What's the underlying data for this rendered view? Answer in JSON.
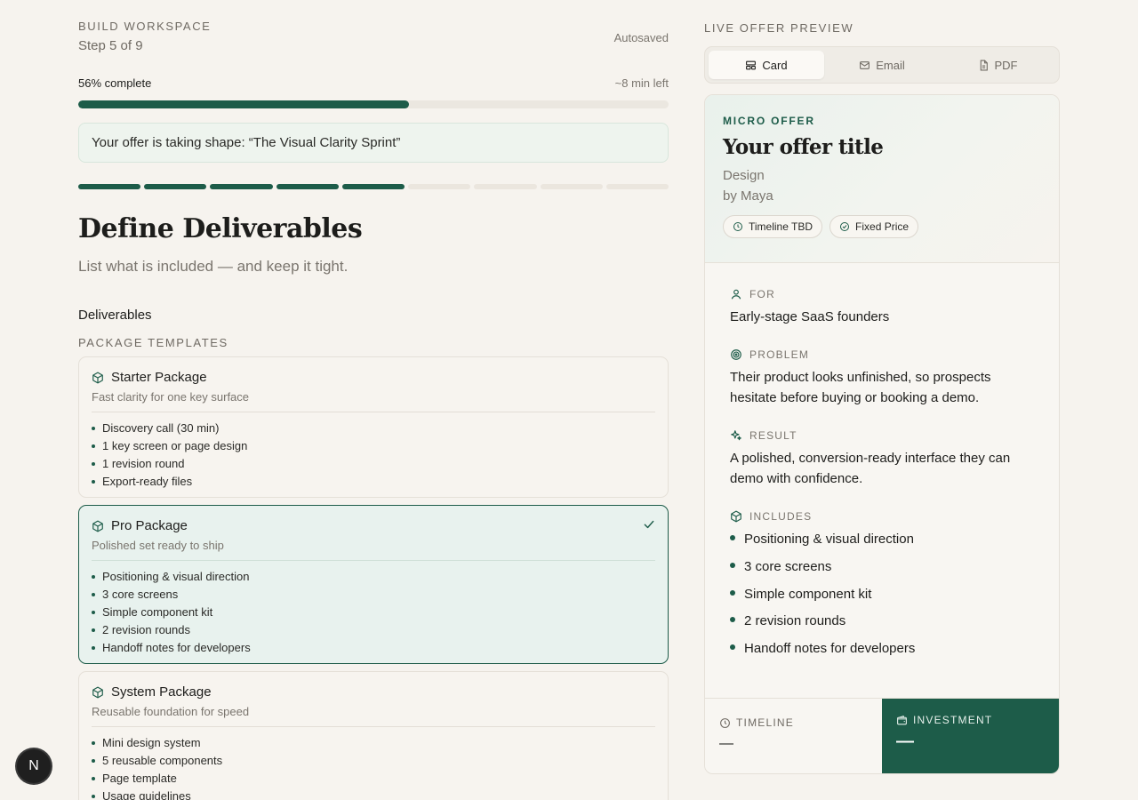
{
  "header": {
    "eyebrow": "BUILD WORKSPACE",
    "step": "Step 5 of 9",
    "status": "Autosaved"
  },
  "progress": {
    "percent_label": "56% complete",
    "percent": 56,
    "time_left": "~8 min left",
    "segments_total": 9,
    "segments_done": 5
  },
  "notice": "Your offer is taking shape: “The Visual Clarity Sprint”",
  "page": {
    "title": "Define Deliverables",
    "subtitle": "List what is included — and keep it tight.",
    "deliverables_label": "Deliverables",
    "templates_label": "PACKAGE TEMPLATES"
  },
  "packages": [
    {
      "name": "Starter Package",
      "description": "Fast clarity for one key surface",
      "items": [
        "Discovery call (30 min)",
        "1 key screen or page design",
        "1 revision round",
        "Export-ready files"
      ],
      "selected": false
    },
    {
      "name": "Pro Package",
      "description": "Polished set ready to ship",
      "items": [
        "Positioning & visual direction",
        "3 core screens",
        "Simple component kit",
        "2 revision rounds",
        "Handoff notes for developers"
      ],
      "selected": true
    },
    {
      "name": "System Package",
      "description": "Reusable foundation for speed",
      "items": [
        "Mini design system",
        "5 reusable components",
        "Page template",
        "Usage guidelines"
      ],
      "selected": false
    }
  ],
  "preview": {
    "label": "LIVE OFFER PREVIEW",
    "tabs": [
      {
        "label": "Card",
        "icon": "card-icon",
        "active": true
      },
      {
        "label": "Email",
        "icon": "mail-icon",
        "active": false
      },
      {
        "label": "PDF",
        "icon": "document-icon",
        "active": false
      }
    ],
    "card": {
      "eyebrow": "MICRO OFFER",
      "title": "Your offer title",
      "category": "Design",
      "author": "by Maya",
      "chips": [
        {
          "label": "Timeline TBD",
          "icon": "clock-icon"
        },
        {
          "label": "Fixed Price",
          "icon": "check-circle-icon"
        }
      ],
      "for_label": "FOR",
      "for_text": "Early-stage SaaS founders",
      "problem_label": "PROBLEM",
      "problem_text": "Their product looks unfinished, so prospects hesitate before buying or booking a demo.",
      "result_label": "RESULT",
      "result_text": "A polished, conversion-ready interface they can demo with confidence.",
      "includes_label": "INCLUDES",
      "includes": [
        "Positioning & visual direction",
        "3 core screens",
        "Simple component kit",
        "2 revision rounds",
        "Handoff notes for developers"
      ],
      "timeline_label": "TIMELINE",
      "timeline_value": "—",
      "investment_label": "INVESTMENT",
      "investment_value": "—"
    }
  },
  "avatar": {
    "initial": "N"
  },
  "colors": {
    "accent": "#1d5c49",
    "background": "#f6f3ee"
  }
}
